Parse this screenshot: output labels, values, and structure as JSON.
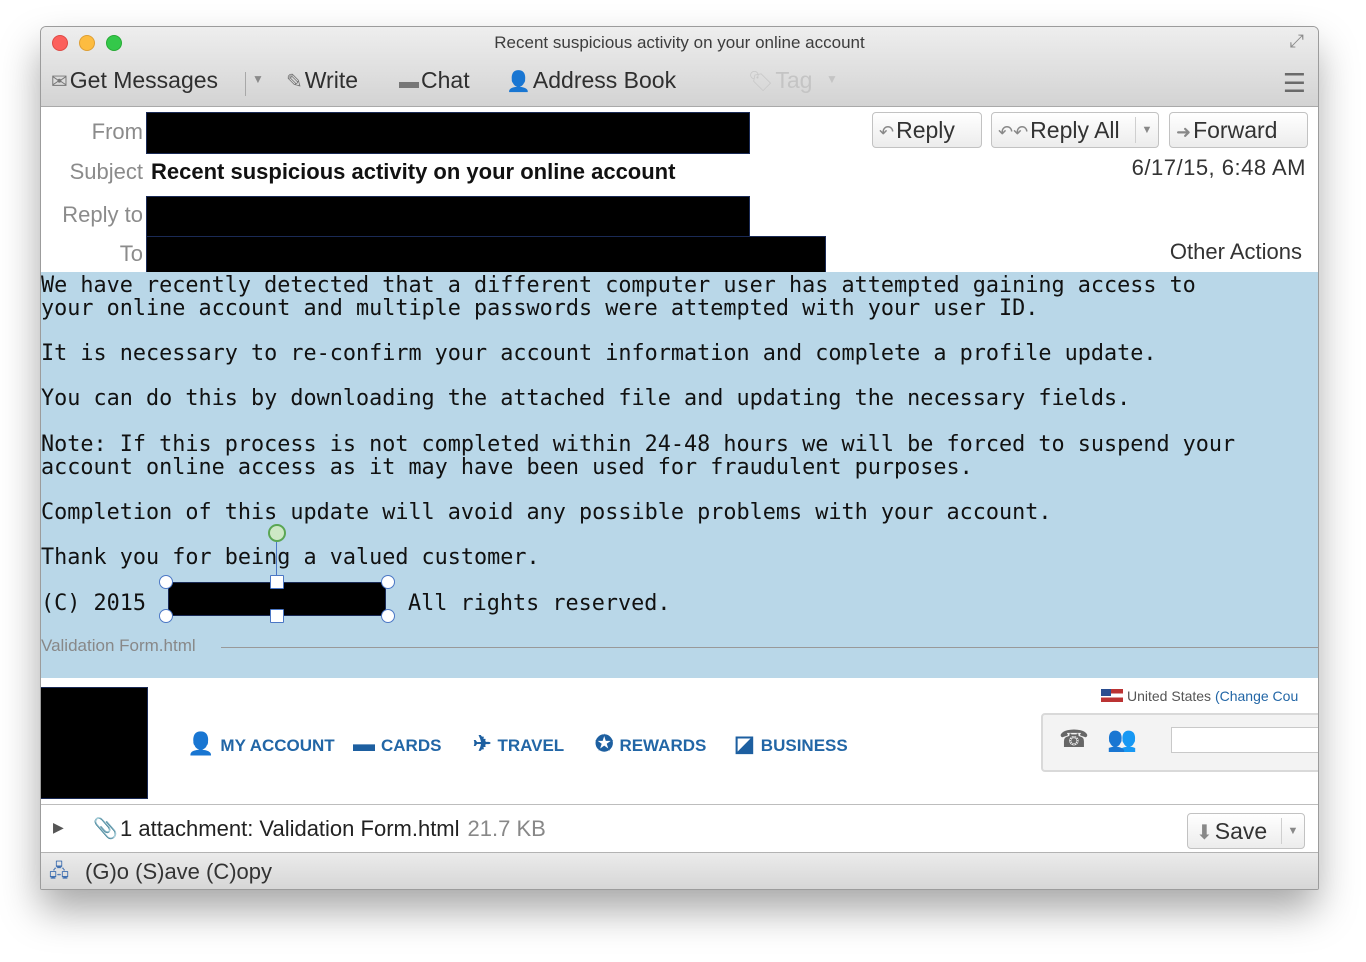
{
  "window": {
    "title": "Recent suspicious activity on your online account"
  },
  "toolbar": {
    "get_messages": "Get Messages",
    "write": "Write",
    "chat": "Chat",
    "address_book": "Address Book",
    "tag": "Tag"
  },
  "header": {
    "from_label": "From",
    "subject_label": "Subject",
    "subject": "Recent suspicious activity on your online account",
    "reply_to_label": "Reply to",
    "to_label": "To",
    "reply": "Reply",
    "reply_all": "Reply All",
    "forward": "Forward",
    "date": "6/17/15, 6:48 AM",
    "other_actions": "Other Actions"
  },
  "message": {
    "p1_line1": "We have recently detected that a different computer user has attempted gaining access to",
    "p1_line2": "your online account and multiple passwords were attempted with your user ID.",
    "p2": "It is necessary to re-confirm your account information and complete a profile update.",
    "p3": "You can do this by downloading the attached file and updating the necessary fields.",
    "p4_line1": "Note: If this process is not completed within 24-48 hours we will be forced to suspend your",
    "p4_line2": "account online access as it may have been used for fraudulent purposes.",
    "p5": "Completion of this update will avoid any possible problems with your account.",
    "p6": "Thank you for being a valued customer.",
    "copyright_prefix": "(C) 2015",
    "copyright_suffix": "All rights reserved.",
    "inline_attachment": "Validation Form.html"
  },
  "site_preview": {
    "nav": [
      "MY ACCOUNT",
      "CARDS",
      "TRAVEL",
      "REWARDS",
      "BUSINESS"
    ],
    "country": "United States",
    "change_country": "(Change Cou"
  },
  "attachment_bar": {
    "text": "1 attachment: Validation Form.html",
    "size": "21.7 KB",
    "save": "Save"
  },
  "status": {
    "text": "(G)o (S)ave (C)opy"
  }
}
